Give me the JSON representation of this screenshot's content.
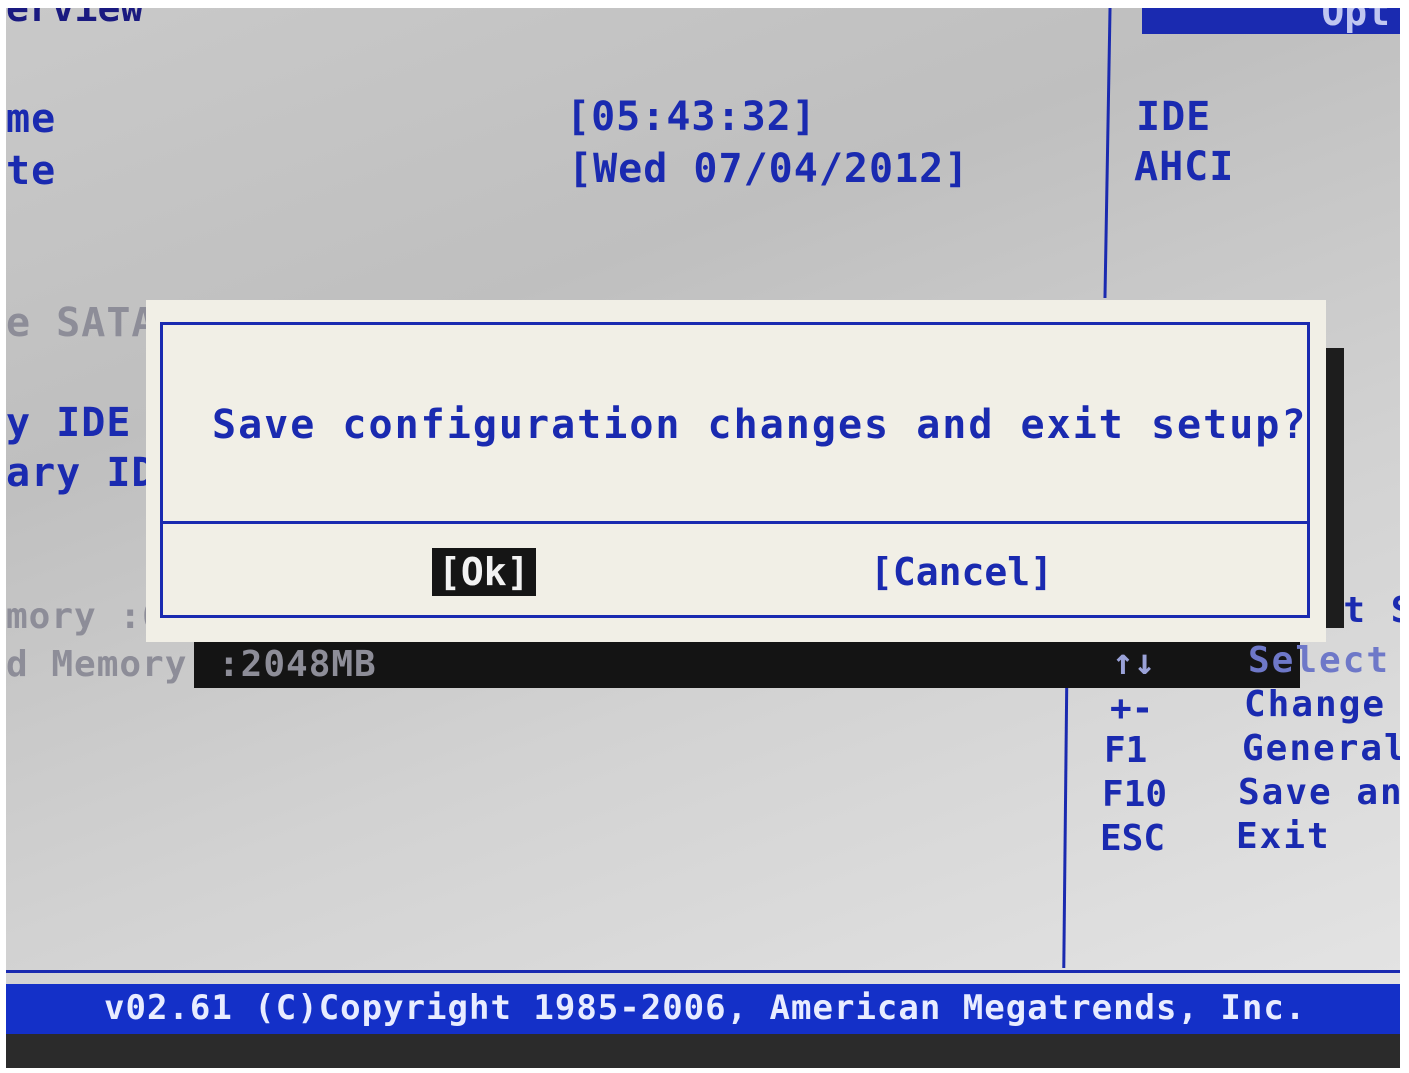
{
  "header": {
    "title_fragment": "erview",
    "right_header_fragment": "Opt"
  },
  "main": {
    "time_label_fragment": "me",
    "date_label_fragment": "te",
    "time_value": "[05:43:32]",
    "date_value": "[Wed 07/04/2012]",
    "sata_label_fragment": "e SATA",
    "ide_label_fragment": "y IDE",
    "secondary_ide_fragment": "ary ID",
    "memory_label_fragment": "mory :6",
    "installed_memory_label_fragment": "d Memory",
    "installed_memory_value": ":2048MB"
  },
  "options": {
    "items": [
      "IDE",
      "AHCI"
    ]
  },
  "help": {
    "partial_top": "ect S",
    "keys": [
      {
        "key": "↑↓",
        "desc": "Select"
      },
      {
        "key": "+-",
        "desc": "Change"
      },
      {
        "key": "F1",
        "desc": "General"
      },
      {
        "key": "F10",
        "desc": "Save an"
      },
      {
        "key": "ESC",
        "desc": "Exit"
      }
    ]
  },
  "dialog": {
    "message": "Save configuration changes and exit setup?",
    "ok_label": "[Ok]",
    "cancel_label": "[Cancel]"
  },
  "footer": {
    "copyright": "v02.61 (C)Copyright 1985-2006, American Megatrends, Inc."
  },
  "colors": {
    "bios_blue": "#1a2ab0",
    "dialog_bg": "#f1efe6",
    "footer_bg": "#1430c8"
  }
}
